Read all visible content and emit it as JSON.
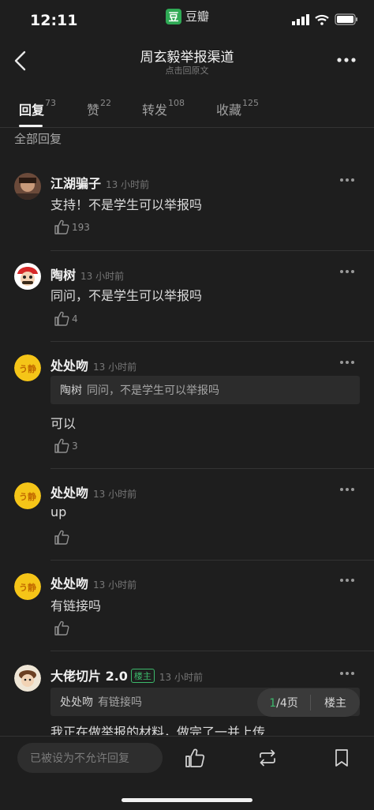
{
  "status": {
    "time": "12:11",
    "app_name": "豆瓣",
    "app_logo_char": "豆"
  },
  "nav": {
    "title": "周玄毅举报渠道",
    "subtitle": "点击回原文"
  },
  "tabs": [
    {
      "label": "回复",
      "count": "73"
    },
    {
      "label": "赞",
      "count": "22"
    },
    {
      "label": "转发",
      "count": "108"
    },
    {
      "label": "收藏",
      "count": "125"
    }
  ],
  "section_label": "全部回复",
  "comments": [
    {
      "name": "江湖骗子",
      "time": "13 小时前",
      "text": "支持！不是学生可以举报吗",
      "likes": "193"
    },
    {
      "name": "陶树",
      "time": "13 小时前",
      "text": "同问，不是学生可以举报吗",
      "likes": "4"
    },
    {
      "name": "处处吻",
      "time": "13 小时前",
      "quote_name": "陶树",
      "quote_text": "同问，不是学生可以举报吗",
      "text": "可以",
      "likes": "3"
    },
    {
      "name": "处处吻",
      "time": "13 小时前",
      "text": "up",
      "likes": ""
    },
    {
      "name": "处处吻",
      "time": "13 小时前",
      "text": "有链接吗",
      "likes": ""
    },
    {
      "name": "大佬切片 2.0",
      "badge": "楼主",
      "time": "13 小时前",
      "quote_name": "处处吻",
      "quote_text": "有链接吗",
      "text": "我正在做举报的材料，做完了一并上传"
    }
  ],
  "pager": {
    "current": "1",
    "total": "/4页",
    "op_label": "楼主"
  },
  "bottom": {
    "reply_placeholder": "已被设为不允许回复"
  },
  "colors": {
    "background": "#1e1e1e",
    "accent": "#3cb96b",
    "text": "#e6e6e6"
  }
}
